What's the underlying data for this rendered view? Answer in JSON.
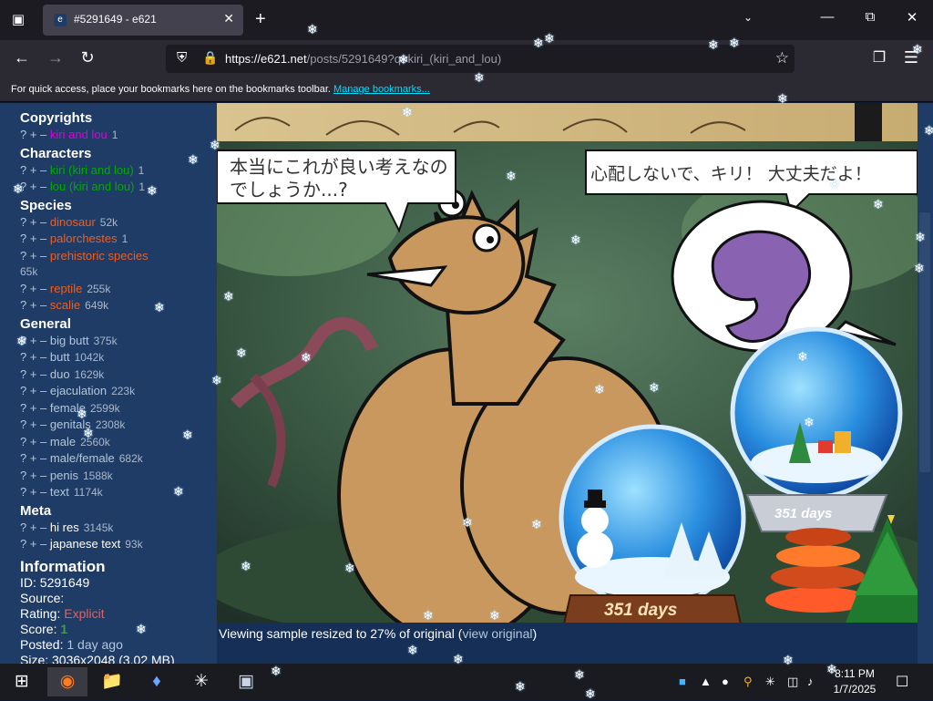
{
  "browser": {
    "tab_title": "#5291649 - e621",
    "tab_favicon": "e",
    "url_host": "https://e621.net",
    "url_rest": "/posts/5291649?q=kiri_(kiri_and_lou)",
    "bookmarks_text": "For quick access, place your bookmarks here on the bookmarks toolbar.",
    "bookmarks_link": "Manage bookmarks..."
  },
  "sidebar": {
    "sections": [
      {
        "title": "Copyrights",
        "kind": "c-copy",
        "tags": [
          {
            "ctl": "? + –",
            "name": "kiri and lou",
            "count": "1"
          }
        ]
      },
      {
        "title": "Characters",
        "kind": "c-char",
        "tags": [
          {
            "ctl": "? + –",
            "name": "kiri (kiri and lou)",
            "count": "1"
          },
          {
            "ctl": "? + –",
            "name": "lou (kiri and lou)",
            "count": "1"
          }
        ]
      },
      {
        "title": "Species",
        "kind": "c-spec",
        "tags": [
          {
            "ctl": "? + –",
            "name": "dinosaur",
            "count": "52k"
          },
          {
            "ctl": "? + –",
            "name": "palorchestes",
            "count": "1"
          },
          {
            "ctl": "? + –",
            "name": "prehistoric species",
            "count": ""
          },
          {
            "ctl": "",
            "name": "",
            "count": "65k"
          },
          {
            "ctl": "? + –",
            "name": "reptile",
            "count": "255k"
          },
          {
            "ctl": "? + –",
            "name": "scalie",
            "count": "649k"
          }
        ]
      },
      {
        "title": "General",
        "kind": "c-gen",
        "tags": [
          {
            "ctl": "? + –",
            "name": "big butt",
            "count": "375k"
          },
          {
            "ctl": "? + –",
            "name": "butt",
            "count": "1042k"
          },
          {
            "ctl": "? + –",
            "name": "duo",
            "count": "1629k"
          },
          {
            "ctl": "? + –",
            "name": "ejaculation",
            "count": "223k"
          },
          {
            "ctl": "? + –",
            "name": "female",
            "count": "2599k"
          },
          {
            "ctl": "? + –",
            "name": "genitals",
            "count": "2308k"
          },
          {
            "ctl": "? + –",
            "name": "male",
            "count": "2560k"
          },
          {
            "ctl": "? + –",
            "name": "male/female",
            "count": "682k"
          },
          {
            "ctl": "? + –",
            "name": "penis",
            "count": "1588k"
          },
          {
            "ctl": "? + –",
            "name": "text",
            "count": "1174k"
          }
        ]
      },
      {
        "title": "Meta",
        "kind": "c-meta",
        "tags": [
          {
            "ctl": "? + –",
            "name": "hi res",
            "count": "3145k"
          },
          {
            "ctl": "? + –",
            "name": "japanese text",
            "count": "93k"
          }
        ]
      }
    ],
    "information": {
      "title": "Information",
      "id_label": "ID:",
      "id": "5291649",
      "source_label": "Source:",
      "rating_label": "Rating:",
      "rating": "Explicit",
      "score_label": "Score:",
      "score": "1",
      "posted_label": "Posted:",
      "posted": "1 day ago",
      "size_label": "Size:",
      "size": "3036x2048 (3.02 MB)"
    }
  },
  "image": {
    "bubble_left": "本当にこれが良い考えなのでしょうか...?",
    "bubble_right": "心配しないで、キリ！ 大丈夫だよ！",
    "globe_small_days": "351 days",
    "globe_large_days": "351 days"
  },
  "resize_note": {
    "text": "Viewing sample resized to 27% of original (",
    "link": "view original",
    "tail": ")"
  },
  "taskbar": {
    "time": "8:11 PM",
    "date": "1/7/2025"
  },
  "colors": {
    "page_bg": "#152f56",
    "sidebar_bg": "#1f3c67",
    "copyright": "#dd00dd",
    "character": "#00aa00",
    "species": "#ed5d1f",
    "general": "#b4c7d9"
  }
}
